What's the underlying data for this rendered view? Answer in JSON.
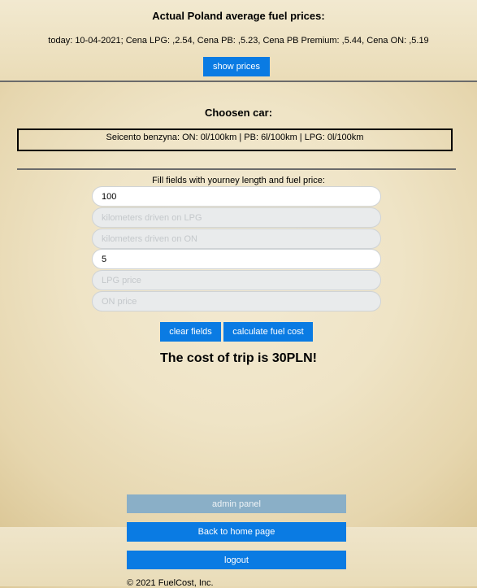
{
  "prices": {
    "title": "Actual Poland average fuel prices:",
    "line": "today: 10-04-2021; Cena LPG: ,2.54, Cena PB: ,5.23, Cena PB Premium: ,5.44, Cena ON: ,5.19",
    "show_button": "show prices"
  },
  "car": {
    "title": "Choosen car:",
    "description": "Seicento benzyna: ON: 0l/100km | PB: 6l/100km | LPG: 0l/100km"
  },
  "form": {
    "hint": "Fill fields with yourney length and fuel price:",
    "km_total": {
      "value": "100",
      "placeholder": ""
    },
    "km_lpg": {
      "value": "",
      "placeholder": "kilometers driven on LPG"
    },
    "km_on": {
      "value": "",
      "placeholder": "kilometers driven on ON"
    },
    "pb_price": {
      "value": "5",
      "placeholder": ""
    },
    "lpg_price": {
      "value": "",
      "placeholder": "LPG price"
    },
    "on_price": {
      "value": "",
      "placeholder": "ON price"
    },
    "clear_button": "clear fields",
    "calc_button": "calculate fuel cost"
  },
  "result": "The cost of trip is 30PLN!",
  "nav": {
    "admin": "admin panel",
    "home": "Back to home page",
    "logout": "logout"
  },
  "footer": "© 2021 FuelCost, Inc.",
  "colors": {
    "accent": "#0a7be3",
    "disabled": "#8aafc7"
  }
}
